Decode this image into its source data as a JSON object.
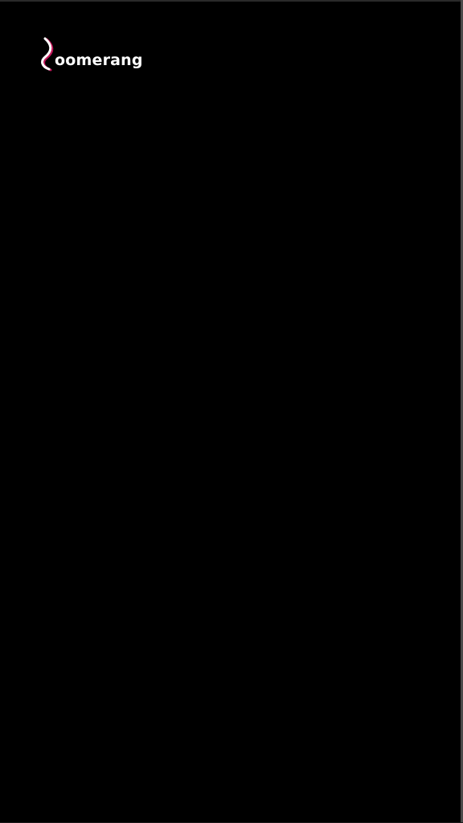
{
  "brand": {
    "name": "oomerang",
    "logo_icon": "boomerang-swoosh-icon",
    "accent_color": "#c2185b",
    "text_color": "#ffffff"
  },
  "screen": {
    "background_color": "#000000"
  }
}
